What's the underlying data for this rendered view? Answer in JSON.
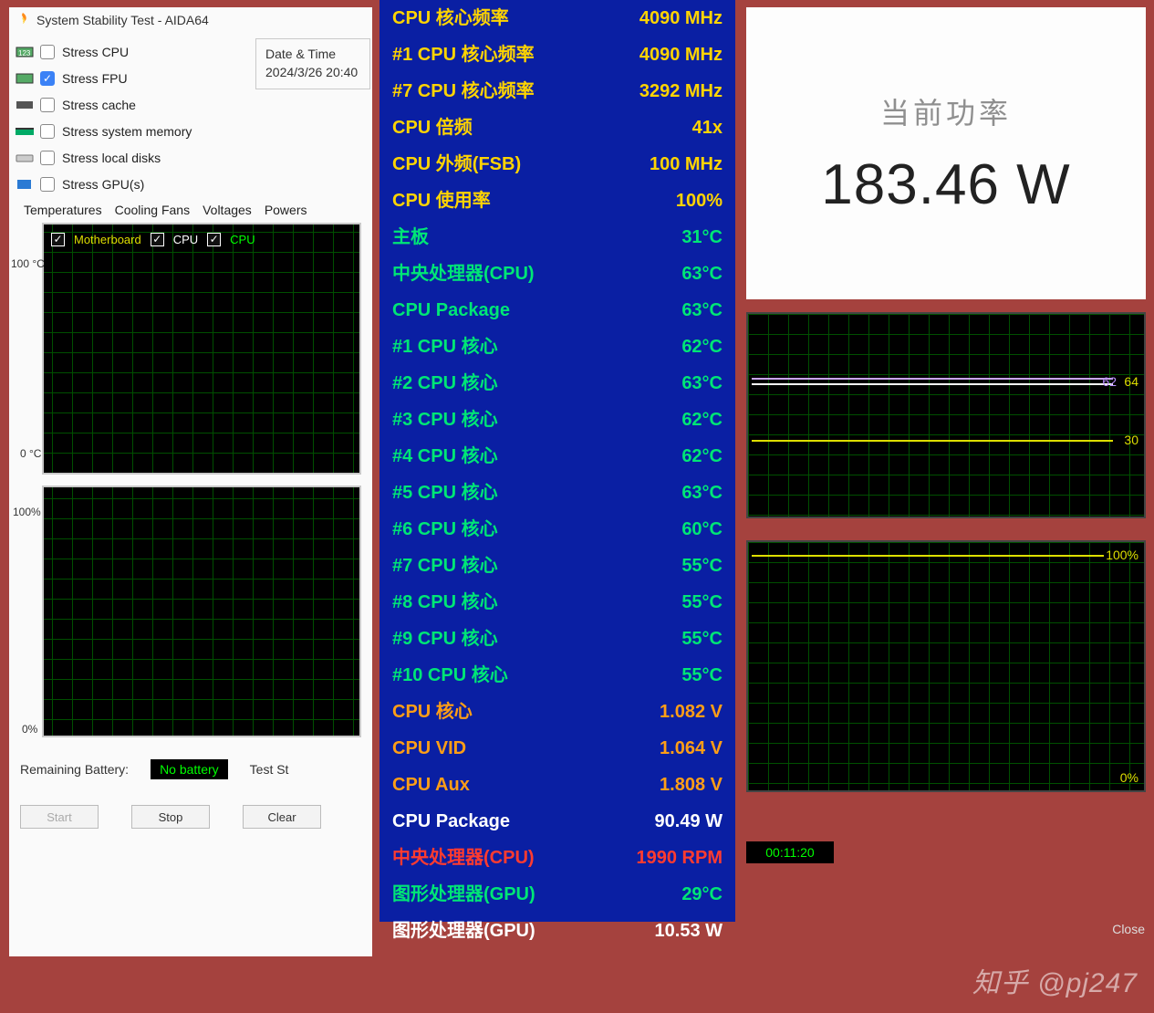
{
  "window": {
    "title": "System Stability Test - AIDA64",
    "datetime_label": "Date & Time",
    "datetime_value": "2024/3/26 20:40"
  },
  "stress_options": [
    {
      "label": "Stress CPU",
      "checked": false
    },
    {
      "label": "Stress FPU",
      "checked": true
    },
    {
      "label": "Stress cache",
      "checked": false
    },
    {
      "label": "Stress system memory",
      "checked": false
    },
    {
      "label": "Stress local disks",
      "checked": false
    },
    {
      "label": "Stress GPU(s)",
      "checked": false
    }
  ],
  "tabs": [
    "Temperatures",
    "Cooling Fans",
    "Voltages",
    "Powers"
  ],
  "legend": [
    "Motherboard",
    "CPU",
    "CPU"
  ],
  "axis": {
    "top_100c": "100 °C",
    "bot_0c": "0 °C",
    "top_100p": "100%",
    "bot_0p": "0%"
  },
  "footer": {
    "battery_label": "Remaining Battery:",
    "battery_value": "No battery",
    "test_status_label": "Test St"
  },
  "buttons": {
    "start": "Start",
    "stop": "Stop",
    "clear": "Clear"
  },
  "timer": "00:11:20",
  "close": "Close",
  "power": {
    "label": "当前功率",
    "value": "183.46 W"
  },
  "watermark": "知乎 @pj247",
  "right_chart1": {
    "v1": "62",
    "v2": "64",
    "v3": "30"
  },
  "right_chart2": {
    "top": "100%",
    "bot": "0%"
  },
  "stats": [
    {
      "label": "CPU 核心频率",
      "value": "4090 MHz",
      "lc": "c-yellow",
      "vc": "c-yellow"
    },
    {
      "label": "#1 CPU 核心频率",
      "value": "4090 MHz",
      "lc": "c-yellow",
      "vc": "c-yellow"
    },
    {
      "label": "#7 CPU 核心频率",
      "value": "3292 MHz",
      "lc": "c-yellow",
      "vc": "c-yellow"
    },
    {
      "label": "CPU 倍频",
      "value": "41x",
      "lc": "c-yellow",
      "vc": "c-yellow"
    },
    {
      "label": "CPU 外频(FSB)",
      "value": "100 MHz",
      "lc": "c-yellow",
      "vc": "c-yellow"
    },
    {
      "label": "CPU 使用率",
      "value": "100%",
      "lc": "c-yellow",
      "vc": "c-yellow"
    },
    {
      "label": "主板",
      "value": "31°C",
      "lc": "c-green",
      "vc": "c-green"
    },
    {
      "label": "中央处理器(CPU)",
      "value": "63°C",
      "lc": "c-green",
      "vc": "c-green"
    },
    {
      "label": "CPU Package",
      "value": "63°C",
      "lc": "c-green",
      "vc": "c-green"
    },
    {
      "label": "#1 CPU 核心",
      "value": "62°C",
      "lc": "c-green",
      "vc": "c-green"
    },
    {
      "label": "#2 CPU 核心",
      "value": "63°C",
      "lc": "c-green",
      "vc": "c-green"
    },
    {
      "label": "#3 CPU 核心",
      "value": "62°C",
      "lc": "c-green",
      "vc": "c-green"
    },
    {
      "label": "#4 CPU 核心",
      "value": "62°C",
      "lc": "c-green",
      "vc": "c-green"
    },
    {
      "label": "#5 CPU 核心",
      "value": "63°C",
      "lc": "c-green",
      "vc": "c-green"
    },
    {
      "label": "#6 CPU 核心",
      "value": "60°C",
      "lc": "c-green",
      "vc": "c-green"
    },
    {
      "label": "#7 CPU 核心",
      "value": "55°C",
      "lc": "c-green",
      "vc": "c-green"
    },
    {
      "label": "#8 CPU 核心",
      "value": "55°C",
      "lc": "c-green",
      "vc": "c-green"
    },
    {
      "label": "#9 CPU 核心",
      "value": "55°C",
      "lc": "c-green",
      "vc": "c-green"
    },
    {
      "label": "#10 CPU 核心",
      "value": "55°C",
      "lc": "c-green",
      "vc": "c-green"
    },
    {
      "label": "CPU 核心",
      "value": "1.082 V",
      "lc": "c-orange",
      "vc": "c-orange"
    },
    {
      "label": "CPU VID",
      "value": "1.064 V",
      "lc": "c-orange",
      "vc": "c-orange"
    },
    {
      "label": "CPU Aux",
      "value": "1.808 V",
      "lc": "c-orange",
      "vc": "c-orange"
    },
    {
      "label": "CPU Package",
      "value": "90.49 W",
      "lc": "c-white",
      "vc": "c-white"
    },
    {
      "label": "中央处理器(CPU)",
      "value": "1990 RPM",
      "lc": "c-red",
      "vc": "c-red"
    },
    {
      "label": "图形处理器(GPU)",
      "value": "29°C",
      "lc": "c-green",
      "vc": "c-green"
    },
    {
      "label": "图形处理器(GPU)",
      "value": "10.53 W",
      "lc": "c-white",
      "vc": "c-white"
    }
  ]
}
